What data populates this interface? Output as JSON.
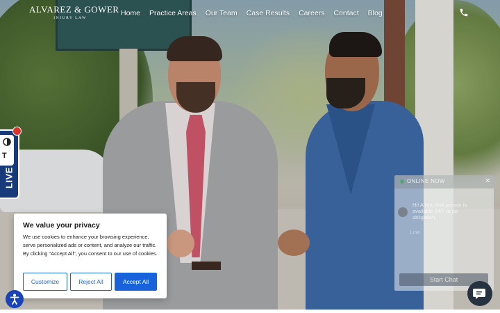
{
  "logo": {
    "name": "ALVAREZ & GOWER",
    "tagline": "INJURY LAW"
  },
  "nav": {
    "items": [
      "Home",
      "Practice Areas",
      "Our Team",
      "Case Results",
      "Careers",
      "Contact",
      "Blog"
    ]
  },
  "header_icons": {
    "phone": "phone-icon"
  },
  "accessibility": {
    "live_label": "LIVE",
    "text_icon": "T",
    "icons": [
      "contrast-icon",
      "text-size-icon",
      "accessibility-icon"
    ]
  },
  "cookie": {
    "title": "We value your privacy",
    "body": "We use cookies to enhance your browsing experience, serve personalized ads or content, and analyze our traffic. By clicking \"Accept All\", you consent to our use of cookies.",
    "customize": "Customize",
    "reject": "Reject All",
    "accept": "Accept All"
  },
  "chat": {
    "status": "ONLINE NOW",
    "message": "Hi! A live, real person is available 24/7 at no obligation.",
    "time": "1 min",
    "start_label": "Start Chat",
    "status_color": "#4aa563"
  },
  "colors": {
    "accent": "#1863dc",
    "a11y": "#173b7a"
  }
}
